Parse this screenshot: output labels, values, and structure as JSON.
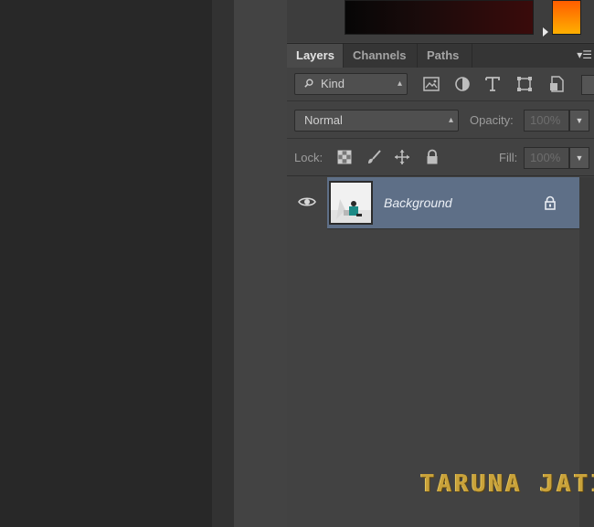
{
  "tabs": [
    {
      "label": "Layers",
      "active": true
    },
    {
      "label": "Channels",
      "active": false
    },
    {
      "label": "Paths",
      "active": false
    }
  ],
  "panel_menu_icon": "panel-menu-icon",
  "filter": {
    "kind_label": "Kind",
    "icons": [
      "pixel-layer-filter-icon",
      "adjustment-filter-icon",
      "type-filter-icon",
      "shape-filter-icon",
      "smart-object-filter-icon"
    ]
  },
  "blend": {
    "mode": "Normal",
    "opacity_label": "Opacity:",
    "opacity_value": "100%"
  },
  "lock": {
    "label": "Lock:",
    "icons": [
      "lock-transparent-pixels-icon",
      "lock-image-pixels-icon",
      "lock-position-icon",
      "lock-all-icon"
    ],
    "fill_label": "Fill:",
    "fill_value": "100%"
  },
  "layers": [
    {
      "name": "Background",
      "visible": true,
      "locked": true,
      "selected": true
    }
  ],
  "watermark": "TARUNA JATI",
  "colors": {
    "selected_layer": "#5e6f87",
    "panel_bg": "#424242",
    "watermark": "#c9a23a"
  }
}
